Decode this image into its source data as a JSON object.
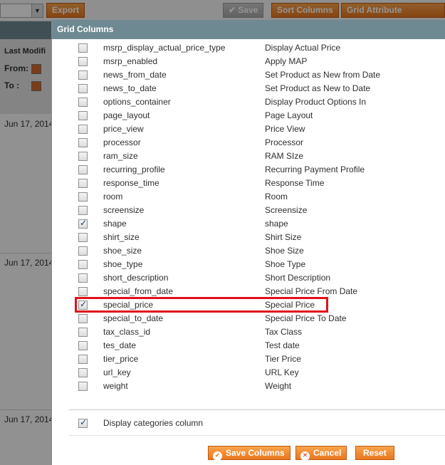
{
  "background": {
    "toolbar": {
      "export_label": "Export",
      "save_label": "Save",
      "sort_columns_label": "Sort Columns",
      "grid_attribute_label": "Grid Attribute Columns"
    },
    "filter": {
      "header": "Last Modifi",
      "from_label": "From:",
      "to_label": "To :"
    },
    "dates": [
      "Jun 17, 2014",
      "Jun 17, 2014",
      "Jun 17, 2014"
    ]
  },
  "dialog": {
    "title": "Grid Columns",
    "columns": [
      {
        "code": "msrp_display_actual_price_type",
        "label": "Display Actual Price",
        "checked": false
      },
      {
        "code": "msrp_enabled",
        "label": "Apply MAP",
        "checked": false
      },
      {
        "code": "news_from_date",
        "label": "Set Product as New from Date",
        "checked": false
      },
      {
        "code": "news_to_date",
        "label": "Set Product as New to Date",
        "checked": false
      },
      {
        "code": "options_container",
        "label": "Display Product Options In",
        "checked": false
      },
      {
        "code": "page_layout",
        "label": "Page Layout",
        "checked": false
      },
      {
        "code": "price_view",
        "label": "Price View",
        "checked": false
      },
      {
        "code": "processor",
        "label": "Processor",
        "checked": false
      },
      {
        "code": "ram_size",
        "label": "RAM SIze",
        "checked": false
      },
      {
        "code": "recurring_profile",
        "label": "Recurring Payment Profile",
        "checked": false
      },
      {
        "code": "response_time",
        "label": "Response Time",
        "checked": false
      },
      {
        "code": "room",
        "label": "Room",
        "checked": false
      },
      {
        "code": "screensize",
        "label": "Screensize",
        "checked": false
      },
      {
        "code": "shape",
        "label": "shape",
        "checked": true
      },
      {
        "code": "shirt_size",
        "label": "Shirt Size",
        "checked": false
      },
      {
        "code": "shoe_size",
        "label": "Shoe Size",
        "checked": false
      },
      {
        "code": "shoe_type",
        "label": "Shoe Type",
        "checked": false
      },
      {
        "code": "short_description",
        "label": "Short Description",
        "checked": false
      },
      {
        "code": "special_from_date",
        "label": "Special Price From Date",
        "checked": false
      },
      {
        "code": "special_price",
        "label": "Special Price",
        "checked": true
      },
      {
        "code": "special_to_date",
        "label": "Special Price To Date",
        "checked": false
      },
      {
        "code": "tax_class_id",
        "label": "Tax Class",
        "checked": false
      },
      {
        "code": "tes_date",
        "label": "Test date",
        "checked": false
      },
      {
        "code": "tier_price",
        "label": "Tier Price",
        "checked": false
      },
      {
        "code": "url_key",
        "label": "URL Key",
        "checked": false
      },
      {
        "code": "weight",
        "label": "Weight",
        "checked": false
      }
    ],
    "display_categories": {
      "label": "Display categories column",
      "checked": true
    },
    "buttons": {
      "save_label": "Save Columns",
      "cancel_label": "Cancel",
      "reset_label": "Reset"
    }
  },
  "colors": {
    "accent": "#e9771f",
    "header_bar": "#6f8992",
    "highlight": "#e0121b"
  }
}
